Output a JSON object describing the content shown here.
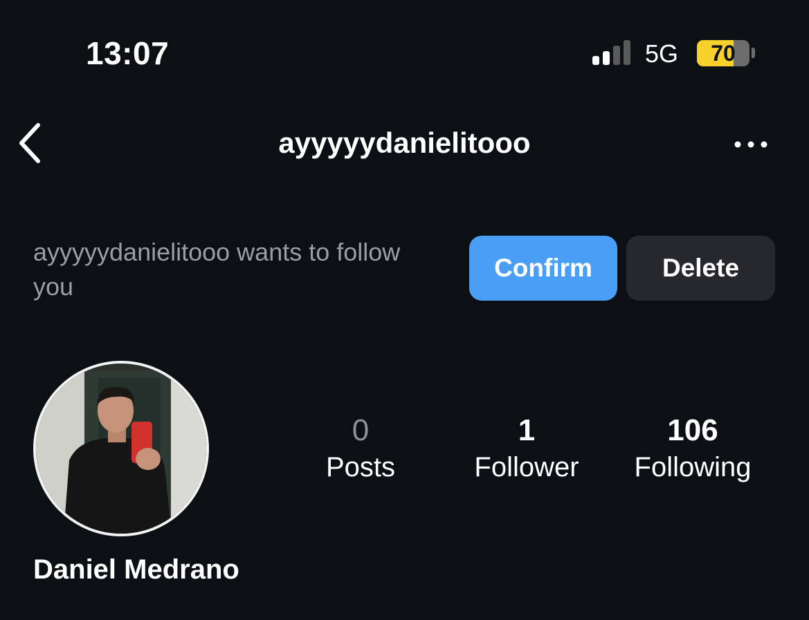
{
  "status_bar": {
    "time": "13:07",
    "network": "5G",
    "battery_level": "70",
    "battery_fraction": 0.7,
    "signal_bars_active": 2,
    "signal_bars_total": 4,
    "battery_color": "#f7d02c"
  },
  "header": {
    "title": "ayyyyydanielitooo",
    "back_icon": "chevron-left-icon",
    "more_icon": "more-horizontal-icon"
  },
  "follow_request": {
    "message": "ayyyyydanielitooo wants to follow you",
    "confirm_label": "Confirm",
    "delete_label": "Delete",
    "confirm_color": "#4a9ff5"
  },
  "profile": {
    "display_name": "Daniel Medrano",
    "stats": {
      "posts_count": "0",
      "posts_label": "Posts",
      "followers_count": "1",
      "followers_label": "Follower",
      "following_count": "106",
      "following_label": "Following"
    }
  }
}
